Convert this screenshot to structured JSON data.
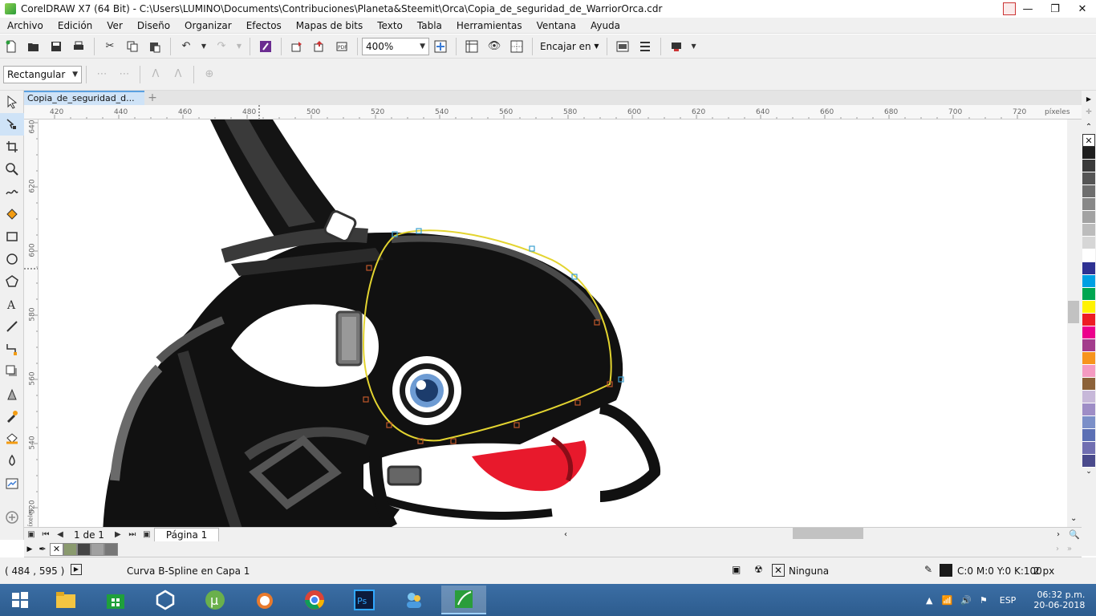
{
  "window": {
    "title": "CorelDRAW X7 (64 Bit) - C:\\Users\\LUMINO\\Documents\\Contribuciones\\Planeta&Steemit\\Orca\\Copia_de_seguridad_de_WarriorOrca.cdr",
    "minimize": "—",
    "maximize": "❐",
    "close": "✕"
  },
  "menu": [
    "Archivo",
    "Edición",
    "Ver",
    "Diseño",
    "Organizar",
    "Efectos",
    "Mapas de bits",
    "Texto",
    "Tabla",
    "Herramientas",
    "Ventana",
    "Ayuda"
  ],
  "toolbar": {
    "zoom_value": "400%",
    "snap_label": "Encajar en"
  },
  "propbar": {
    "mode_value": "Rectangular"
  },
  "document": {
    "tab_label": "Copia_de_seguridad_d...",
    "add_tab": "+"
  },
  "hruler": {
    "unit": "píxeles",
    "ticks": [
      "420",
      "440",
      "460",
      "480",
      "500",
      "520",
      "540",
      "560",
      "580",
      "600",
      "620",
      "640",
      "660",
      "680",
      "700",
      "720"
    ]
  },
  "vruler": {
    "unit": "píxeles",
    "ticks": [
      "640",
      "620",
      "600",
      "580",
      "560",
      "540",
      "520"
    ]
  },
  "pagenav": {
    "page_of": "1 de 1",
    "page_tab": "Página 1"
  },
  "palette_colors": [
    "#1e1e1e",
    "#3a3a3a",
    "#555555",
    "#6e6e6e",
    "#888888",
    "#a2a2a2",
    "#bcbcbc",
    "#d6d6d6",
    "#ffffff",
    "#2e3192",
    "#00a0e3",
    "#00a651",
    "#fff200",
    "#ed1c24",
    "#ec008c",
    "#a33c8c",
    "#f7941d",
    "#f49ac1",
    "#8c6239",
    "#c7b8d9",
    "#9e8dc6",
    "#7b8fc8",
    "#5b6fb4",
    "#706eb1",
    "#4a4a8c"
  ],
  "doc_palette": [
    "#8a9a6e",
    "#444444",
    "#a0a0a0",
    "#777777"
  ],
  "status": {
    "coords": "( 484 , 595 )",
    "object_info": "Curva B-Spline en Capa 1",
    "fill_label": "Ninguna",
    "outline_color": "C:0 M:0 Y:0 K:100",
    "outline_width": "2 px"
  },
  "taskbar": {
    "language": "ESP",
    "time": "06:32 p.m.",
    "date": "20-06-2018"
  }
}
